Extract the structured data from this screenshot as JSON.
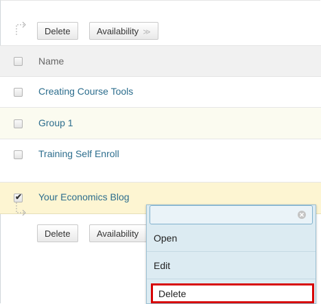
{
  "toolbar": {
    "delete_label": "Delete",
    "availability_label": "Availability",
    "availability_chevron": "≫"
  },
  "table": {
    "header_name": "Name",
    "rows": [
      {
        "name": "Creating Course Tools",
        "checked": false
      },
      {
        "name": "Group 1",
        "checked": false
      },
      {
        "name": "Training Self Enroll",
        "checked": false
      },
      {
        "name": "Your Economics Blog",
        "checked": true
      }
    ]
  },
  "context_menu": {
    "items": [
      "Open",
      "Edit",
      "Delete"
    ],
    "highlight_color": "#d70000"
  },
  "icons": {
    "check_mark": "✔",
    "close": "close-icon",
    "arrow": "arrow-icon"
  }
}
